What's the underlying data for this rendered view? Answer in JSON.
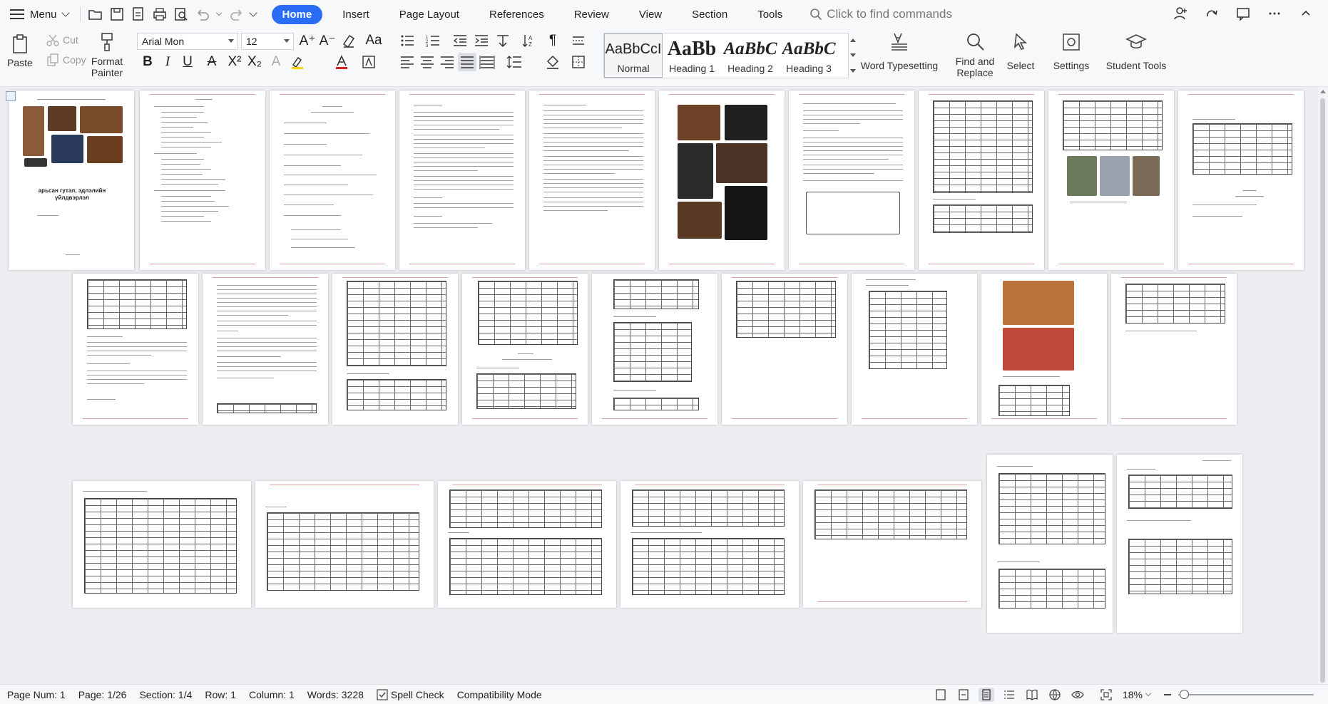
{
  "menubar": {
    "menu_label": "Menu",
    "tabs": [
      "Home",
      "Insert",
      "Page Layout",
      "References",
      "Review",
      "View",
      "Section",
      "Tools"
    ],
    "active_tab": "Home",
    "search_placeholder": "Click to find commands"
  },
  "ribbon": {
    "paste": "Paste",
    "cut": "Cut",
    "copy": "Copy",
    "format_painter": "Format Painter",
    "font_name": "Arial Mon",
    "font_size": "12",
    "styles": [
      {
        "sample": "AaBbCcI",
        "name": "Normal"
      },
      {
        "sample": "AaBb",
        "name": "Heading 1"
      },
      {
        "sample": "AaBbC",
        "name": "Heading 2"
      },
      {
        "sample": "AaBbC",
        "name": "Heading 3"
      }
    ],
    "word_typesetting": "Word Typesetting",
    "find_replace": "Find and Replace",
    "select": "Select",
    "settings": "Settings",
    "student_tools": "Student Tools"
  },
  "document": {
    "cover_title": "арьсан гутал, эдлэлийн үйлдвэрлэл",
    "page_count": 26,
    "accent_color": "#d9a0a0"
  },
  "status": {
    "page_num": "Page Num: 1",
    "page": "Page: 1/26",
    "section": "Section: 1/4",
    "row": "Row: 1",
    "column": "Column: 1",
    "words": "Words: 3228",
    "spell_check": "Spell Check",
    "compat_mode": "Compatibility Mode",
    "zoom": "18%"
  },
  "colors": {
    "accent": "#2a6df4",
    "toolbar_bg": "#f7f8fa",
    "doc_bg": "#eceef1"
  }
}
